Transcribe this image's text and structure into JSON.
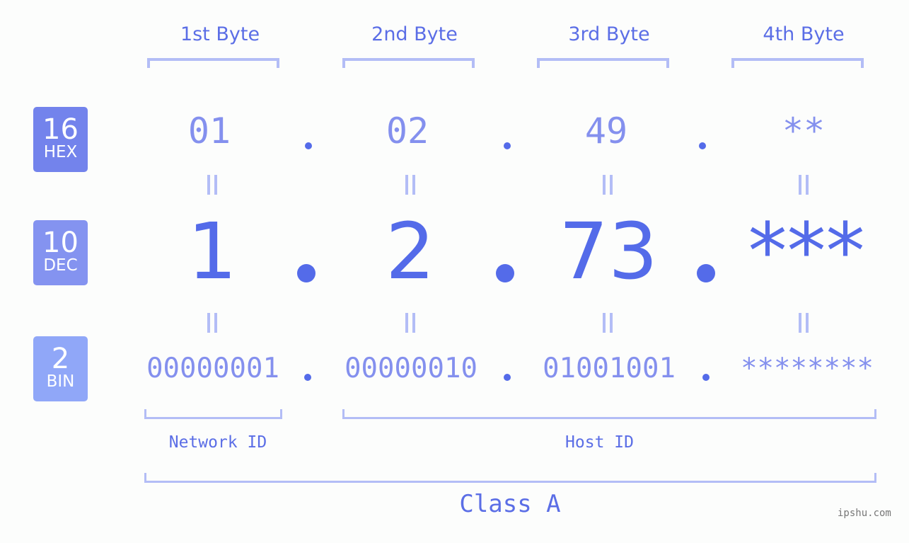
{
  "bytes": [
    {
      "header": "1st Byte",
      "hex": "01",
      "dec": "1",
      "bin": "00000001"
    },
    {
      "header": "2nd Byte",
      "hex": "02",
      "dec": "2",
      "bin": "00000010"
    },
    {
      "header": "3rd Byte",
      "hex": "49",
      "dec": "73",
      "bin": "01001001"
    },
    {
      "header": "4th Byte",
      "hex": "**",
      "dec": "***",
      "bin": "********"
    }
  ],
  "badges": {
    "hex": {
      "num": "16",
      "label": "HEX",
      "color": "#7383ec"
    },
    "dec": {
      "num": "10",
      "label": "DEC",
      "color": "#8493f0"
    },
    "bin": {
      "num": "2",
      "label": "BIN",
      "color": "#90a7f8"
    }
  },
  "labels": {
    "network_id": "Network ID",
    "host_id": "Host ID",
    "class": "Class A"
  },
  "watermark": "ipshu.com",
  "colors": {
    "accent": "#546be9",
    "light_value": "#8490ee",
    "bracket": "#b3bdf6",
    "background": "#fcfdfc"
  }
}
